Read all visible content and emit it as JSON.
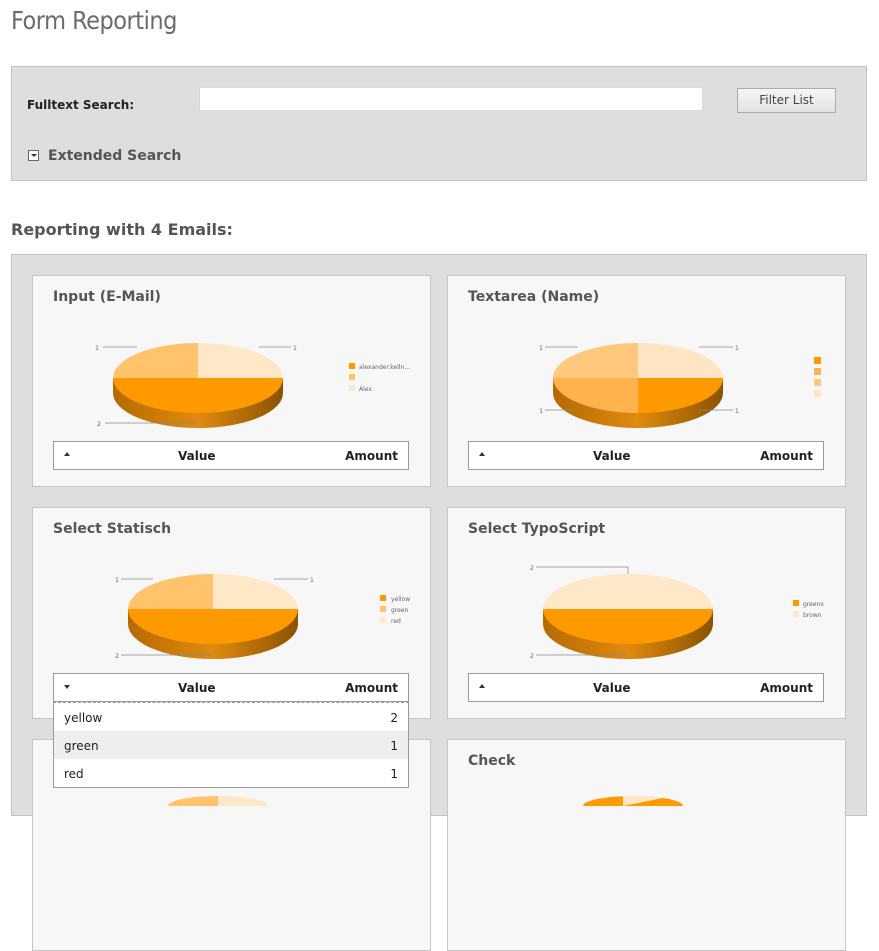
{
  "page": {
    "title": "Form Reporting"
  },
  "filter": {
    "fulltext_label": "Fulltext Search:",
    "search_value": "",
    "button_label": "Filter List",
    "extended_label": "Extended Search"
  },
  "report": {
    "heading": "Reporting with 4 Emails:",
    "table_value_header": "Value",
    "table_amount_header": "Amount",
    "cards": [
      {
        "title": "Input (E-Mail)",
        "chart": {
          "type": "pie",
          "slices": [
            {
              "label": "alexander.kelln...",
              "value": 2,
              "color": "#ff9900"
            },
            {
              "label": "",
              "value": 1,
              "color": "#ffc36b"
            },
            {
              "label": "Alex",
              "value": 1,
              "color": "#ffe8c8"
            }
          ],
          "callouts": [
            "1",
            "1",
            "2"
          ]
        }
      },
      {
        "title": "Textarea (Name)",
        "chart": {
          "type": "pie",
          "slices": [
            {
              "label": "",
              "value": 1,
              "color": "#ff9900"
            },
            {
              "label": "",
              "value": 1,
              "color": "#ffb24d"
            },
            {
              "label": "",
              "value": 1,
              "color": "#ffc87d"
            },
            {
              "label": "",
              "value": 1,
              "color": "#ffe5c3"
            }
          ],
          "callouts": [
            "1",
            "1",
            "1",
            "1"
          ]
        }
      },
      {
        "title": "Select Statisch",
        "chart": {
          "type": "pie",
          "slices": [
            {
              "label": "yellow",
              "value": 2,
              "color": "#ff9900"
            },
            {
              "label": "green",
              "value": 1,
              "color": "#ffc36b"
            },
            {
              "label": "red",
              "value": 1,
              "color": "#ffe8c8"
            }
          ],
          "callouts": [
            "1",
            "1",
            "2"
          ]
        },
        "rows": [
          {
            "value": "yellow",
            "amount": "2"
          },
          {
            "value": "green",
            "amount": "1"
          },
          {
            "value": "red",
            "amount": "1"
          }
        ]
      },
      {
        "title": "Select TypoScript",
        "chart": {
          "type": "pie",
          "slices": [
            {
              "label": "greenx",
              "value": 2,
              "color": "#ff9900"
            },
            {
              "label": "brown",
              "value": 2,
              "color": "#ffe8c8"
            }
          ],
          "callouts": [
            "2",
            "2"
          ]
        }
      },
      {
        "title": "Check"
      }
    ]
  }
}
